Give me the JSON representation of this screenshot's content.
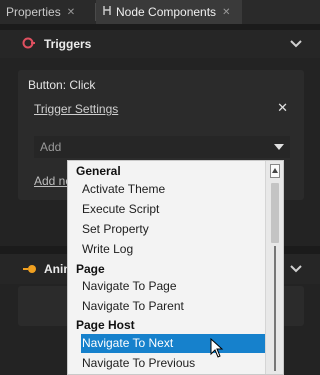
{
  "tabs": [
    {
      "label": "Properties",
      "close": "✕"
    },
    {
      "label": "Node Components",
      "close": "✕"
    }
  ],
  "triggers_panel": {
    "title": "Triggers",
    "event_label": "Button: Click",
    "trigger_settings_link": "Trigger Settings",
    "remove_symbol": "✕",
    "add_select_placeholder": "Add",
    "add_link_text": "Add ne"
  },
  "animation_panel": {
    "title": "Anim"
  },
  "dropdown": {
    "groups": [
      {
        "header": "General",
        "items": [
          "Activate Theme",
          "Execute Script",
          "Set Property",
          "Write Log"
        ]
      },
      {
        "header": "Page",
        "items": [
          "Navigate To Page",
          "Navigate To Parent"
        ]
      },
      {
        "header": "Page Host",
        "items": [
          "Navigate To Next",
          "Navigate To Previous"
        ]
      }
    ],
    "selected": "Navigate To Next"
  },
  "colors": {
    "accent": "#1681cc",
    "trigger_icon": "#e05060",
    "animation_icon": "#f0a020"
  },
  "icons": [
    "node-components-icon",
    "trigger-icon",
    "animation-icon",
    "chevron-down-icon",
    "close-icon",
    "dropdown-arrow-icon",
    "mouse-pointer-icon"
  ]
}
